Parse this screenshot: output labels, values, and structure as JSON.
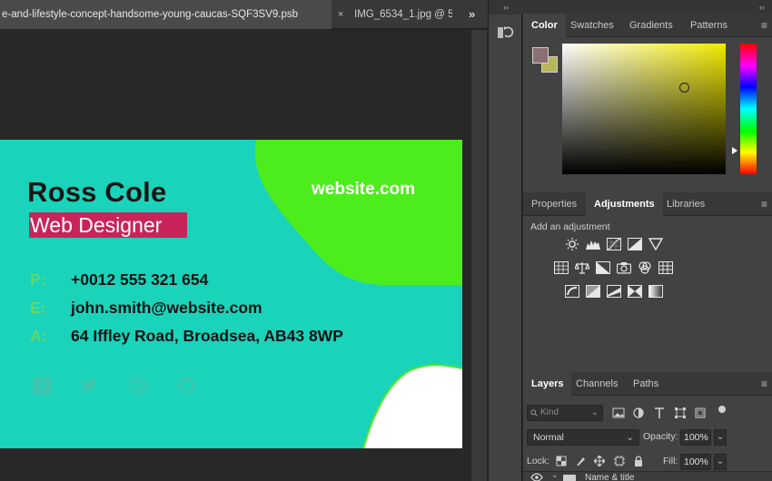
{
  "document_tabs": {
    "active_tab": "e-and-lifestyle-concept-handsome-young-caucas-SQF3SV9.psb",
    "second_tab": "IMG_6534_1.jpg @ 5",
    "close_glyph": "×",
    "more_glyph": "»"
  },
  "panels_header": {
    "collapse_glyph": "‹‹"
  },
  "dock": {
    "header_glyph": "››",
    "history_icon": "history-brush-icon"
  },
  "color_panel": {
    "tabs": [
      "Color",
      "Swatches",
      "Gradients",
      "Patterns"
    ],
    "active_tab": "Color",
    "menu_glyph": "≡",
    "foreground_color": "#8c6f73",
    "background_color": "#b6b65a",
    "hue_color": "#f1ea00"
  },
  "adjustments_panel": {
    "tabs": [
      "Properties",
      "Adjustments",
      "Libraries"
    ],
    "active_tab": "Adjustments",
    "menu_glyph": "≡",
    "label": "Add an adjustment",
    "icons_row1": [
      "brightness-icon",
      "levels-icon",
      "curves-icon",
      "exposure-icon",
      "vibrance-icon"
    ],
    "icons_row2": [
      "hue-saturation-icon",
      "color-balance-icon",
      "black-white-icon",
      "photo-filter-icon",
      "channel-mixer-icon",
      "color-lookup-icon"
    ],
    "icons_row3": [
      "invert-icon",
      "posterize-icon",
      "threshold-icon",
      "selective-color-icon",
      "gradient-map-icon"
    ]
  },
  "layers_panel": {
    "tabs": [
      "Layers",
      "Channels",
      "Paths"
    ],
    "active_tab": "Layers",
    "menu_glyph": "≡",
    "kind_placeholder": "Kind",
    "blend_mode": "Normal",
    "opacity_label": "Opacity:",
    "opacity_value": "100%",
    "lock_label": "Lock:",
    "fill_label": "Fill:",
    "fill_value": "100%",
    "chevron_glyph": "⌄",
    "visible_layer_name": "Name & title"
  },
  "business_card": {
    "name": "Ross Cole",
    "role": "Web Designer",
    "website": "website.com",
    "contacts": [
      {
        "key": "P:",
        "value": "+0012 555 321 654"
      },
      {
        "key": "E:",
        "value": "john.smith@website.com"
      },
      {
        "key": "A:",
        "value": "64  Iffley Road, Broadsea, AB43 8WP"
      }
    ],
    "socials": [
      "facebook-icon",
      "twitter-icon",
      "dribbble-icon",
      "github-icon"
    ],
    "colors": {
      "base": "#1ad3bb",
      "blob": "#4ded1d",
      "white_shape": "#ffffff",
      "role_highlight": "#c9245a",
      "key_letters": "#63d86a"
    }
  }
}
